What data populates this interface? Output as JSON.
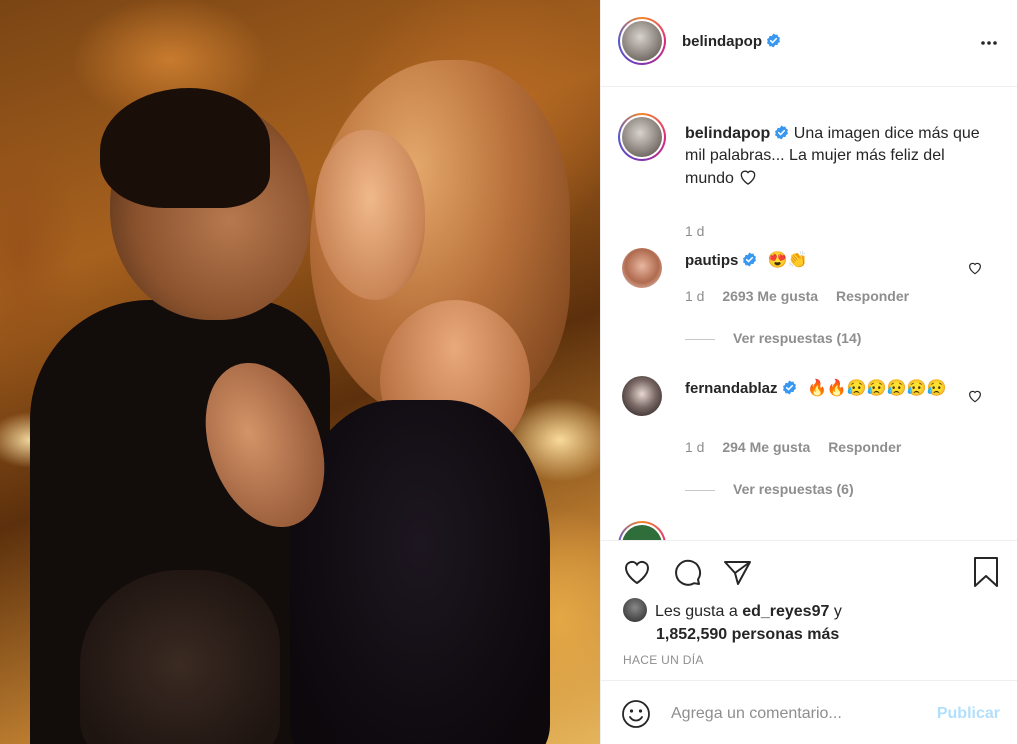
{
  "post": {
    "author": "belindapop",
    "verified": true,
    "more_icon": "more-horizontal-icon"
  },
  "caption": {
    "username": "belindapop",
    "text": "Una imagen dice más que mil palabras... La mujer más feliz del mundo",
    "trailing_icon": "heart-outline-icon",
    "age": "1 d"
  },
  "comments": [
    {
      "username": "pautips",
      "verified": true,
      "text": "😍👏",
      "age": "1 d",
      "likes": "2693 Me gusta",
      "reply": "Responder",
      "replies": "Ver respuestas (14)"
    },
    {
      "username": "fernandablaz",
      "verified": true,
      "text": "🔥🔥😥😥😥😥😥",
      "age": "1 d",
      "likes": "294 Me gusta",
      "reply": "Responder",
      "replies": "Ver respuestas (6)"
    }
  ],
  "likes": {
    "prefix": "Les gusta a",
    "user": "ed_reyes97",
    "joiner": "y",
    "count": "1,852,590 personas más"
  },
  "time_ago": "HACE UN DÍA",
  "comment_box": {
    "placeholder": "Agrega un comentario...",
    "publish": "Publicar"
  },
  "colors": {
    "verified": "#3897f0",
    "publish_disabled": "#b2dffc",
    "meta": "#8e8e8e"
  }
}
